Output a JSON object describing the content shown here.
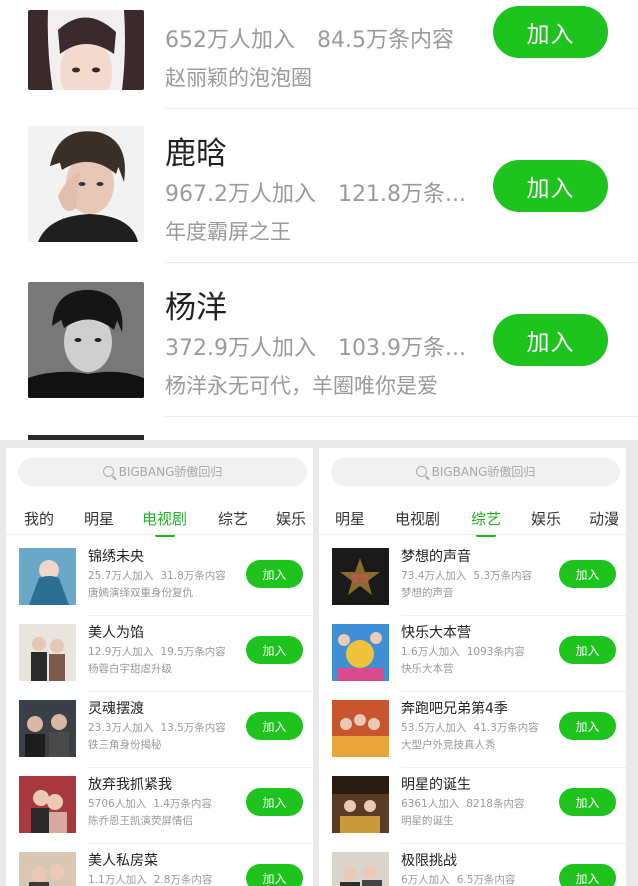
{
  "top_list": [
    {
      "name": "",
      "joined": "652万人加入",
      "content": "84.5万条内容",
      "desc": "赵丽颖的泡泡圈",
      "button": "加入"
    },
    {
      "name": "鹿晗",
      "joined": "967.2万人加入",
      "content": "121.8万条...",
      "desc": "年度霸屏之王",
      "button": "加入"
    },
    {
      "name": "杨洋",
      "joined": "372.9万人加入",
      "content": "103.9万条...",
      "desc": "杨洋永无可代，羊圈唯你是爱",
      "button": "加入"
    }
  ],
  "left_panel": {
    "search_placeholder": "BIGBANG骄傲回归",
    "tabs": [
      "我的",
      "明星",
      "电视剧",
      "综艺",
      "娱乐"
    ],
    "active_tab": "电视剧",
    "items": [
      {
        "title": "锦绣未央",
        "joined": "25.7万人加入",
        "content": "31.8万条内容",
        "desc": "唐嫣演绎双重身份复仇",
        "button": "加入"
      },
      {
        "title": "美人为馅",
        "joined": "12.9万人加入",
        "content": "19.5万条内容",
        "desc": "杨蓉白宇甜虐升级",
        "button": "加入"
      },
      {
        "title": "灵魂摆渡",
        "joined": "23.3万人加入",
        "content": "13.5万条内容",
        "desc": "铁三角身份揭秘",
        "button": "加入"
      },
      {
        "title": "放弃我抓紧我",
        "joined": "5706人加入",
        "content": "1.4万条内容",
        "desc": "陈乔恩王凯演荧屏情侣",
        "button": "加入"
      },
      {
        "title": "美人私房菜",
        "joined": "1.1万人加入",
        "content": "2.8万条内容",
        "desc": "",
        "button": "加入"
      }
    ]
  },
  "right_panel": {
    "search_placeholder": "BIGBANG骄傲回归",
    "tabs": [
      "明星",
      "电视剧",
      "综艺",
      "娱乐",
      "动漫"
    ],
    "active_tab": "综艺",
    "items": [
      {
        "title": "梦想的声音",
        "joined": "73.4万人加入",
        "content": "5.3万条内容",
        "desc": "梦想的声音",
        "button": "加入"
      },
      {
        "title": "快乐大本营",
        "joined": "1.6万人加入",
        "content": "1093条内容",
        "desc": "快乐大本营",
        "button": "加入"
      },
      {
        "title": "奔跑吧兄弟第4季",
        "joined": "53.5万人加入",
        "content": "41.3万条内容",
        "desc": "大型户外竞技真人秀",
        "button": "加入"
      },
      {
        "title": "明星的诞生",
        "joined": "6361人加入",
        "content": "8218条内容",
        "desc": "明星的诞生",
        "button": "加入"
      },
      {
        "title": "极限挑战",
        "joined": "6万人加入",
        "content": "6.5万条内容",
        "desc": "",
        "button": "加入"
      }
    ]
  },
  "colors": {
    "accent": "#1ec31e",
    "active_tab": "#22b422",
    "muted_text": "#999999"
  }
}
